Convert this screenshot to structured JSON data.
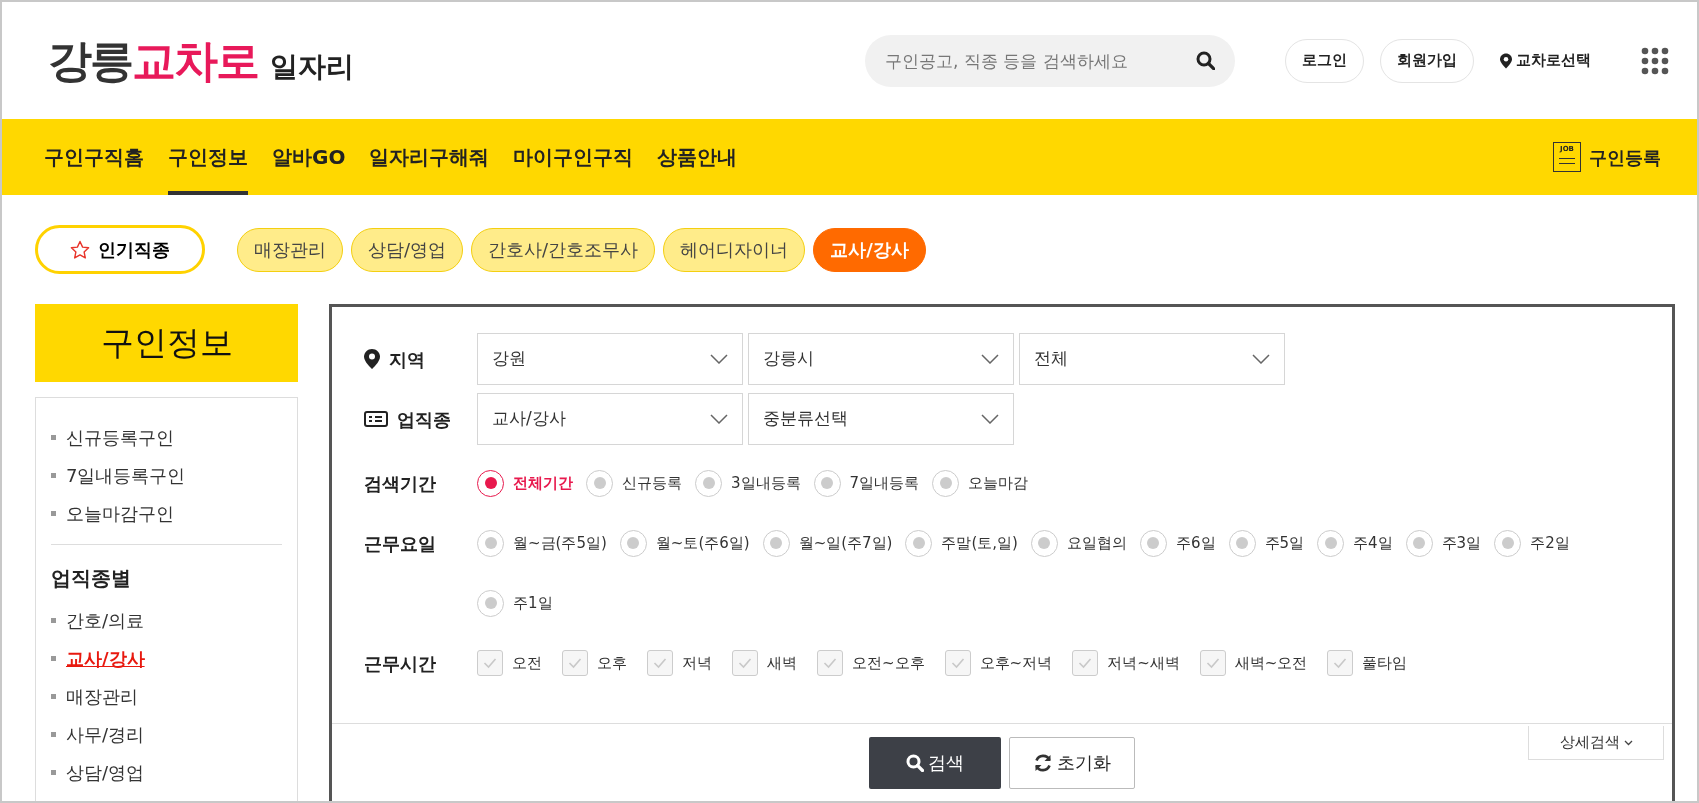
{
  "logo": {
    "part1": "강릉",
    "part2": "교차로",
    "part3": "일자리"
  },
  "search": {
    "placeholder": "구인공고, 직종 등을 검색하세요"
  },
  "header_links": [
    {
      "label": "로그인",
      "kind": "button"
    },
    {
      "label": "회원가입",
      "kind": "button"
    },
    {
      "label": "교차로선택",
      "kind": "location"
    }
  ],
  "nav": {
    "items": [
      {
        "label": "구인구직홈",
        "selected": false
      },
      {
        "label": "구인정보",
        "selected": true
      },
      {
        "label": "알바GO",
        "selected": false
      },
      {
        "label": "일자리구해줘",
        "selected": false
      },
      {
        "label": "마이구인구직",
        "selected": false
      },
      {
        "label": "상품안내",
        "selected": false
      }
    ],
    "register": "구인등록",
    "register_icon_text": "JOB"
  },
  "popular": {
    "label": "인기직종",
    "chips": [
      {
        "label": "매장관리",
        "selected": false
      },
      {
        "label": "상담/영업",
        "selected": false
      },
      {
        "label": "간호사/간호조무사",
        "selected": false
      },
      {
        "label": "헤어디자이너",
        "selected": false
      },
      {
        "label": "교사/강사",
        "selected": true
      }
    ]
  },
  "sidebar": {
    "title": "구인정보",
    "items": [
      "신규등록구인",
      "7일내등록구인",
      "오늘마감구인"
    ],
    "section_title": "업직종별",
    "categories": [
      {
        "label": "간호/의료",
        "selected": false
      },
      {
        "label": "교사/강사",
        "selected": true
      },
      {
        "label": "매장관리",
        "selected": false
      },
      {
        "label": "사무/경리",
        "selected": false
      },
      {
        "label": "상담/영업",
        "selected": false
      }
    ]
  },
  "filters": {
    "region": {
      "label": "지역",
      "selects": [
        "강원",
        "강릉시",
        "전체"
      ]
    },
    "job": {
      "label": "업직종",
      "selects": [
        "교사/강사",
        "중분류선택"
      ]
    },
    "period": {
      "label": "검색기간",
      "options": [
        {
          "label": "전체기간",
          "selected": true
        },
        {
          "label": "신규등록",
          "selected": false
        },
        {
          "label": "3일내등록",
          "selected": false
        },
        {
          "label": "7일내등록",
          "selected": false
        },
        {
          "label": "오늘마감",
          "selected": false
        }
      ]
    },
    "days": {
      "label": "근무요일",
      "options": [
        {
          "label": "월~금(주5일)",
          "selected": false
        },
        {
          "label": "월~토(주6일)",
          "selected": false
        },
        {
          "label": "월~일(주7일)",
          "selected": false
        },
        {
          "label": "주말(토,일)",
          "selected": false
        },
        {
          "label": "요일협의",
          "selected": false
        },
        {
          "label": "주6일",
          "selected": false
        },
        {
          "label": "주5일",
          "selected": false
        },
        {
          "label": "주4일",
          "selected": false
        },
        {
          "label": "주3일",
          "selected": false
        },
        {
          "label": "주2일",
          "selected": false
        },
        {
          "label": "주1일",
          "selected": false
        }
      ]
    },
    "hours": {
      "label": "근무시간",
      "options": [
        {
          "label": "오전",
          "checked": false
        },
        {
          "label": "오후",
          "checked": false
        },
        {
          "label": "저녁",
          "checked": false
        },
        {
          "label": "새벽",
          "checked": false
        },
        {
          "label": "오전~오후",
          "checked": false
        },
        {
          "label": "오후~저녁",
          "checked": false
        },
        {
          "label": "저녁~새벽",
          "checked": false
        },
        {
          "label": "새벽~오전",
          "checked": false
        },
        {
          "label": "풀타임",
          "checked": false
        }
      ]
    }
  },
  "buttons": {
    "search": "검색",
    "reset": "초기화",
    "detail": "상세검색"
  }
}
